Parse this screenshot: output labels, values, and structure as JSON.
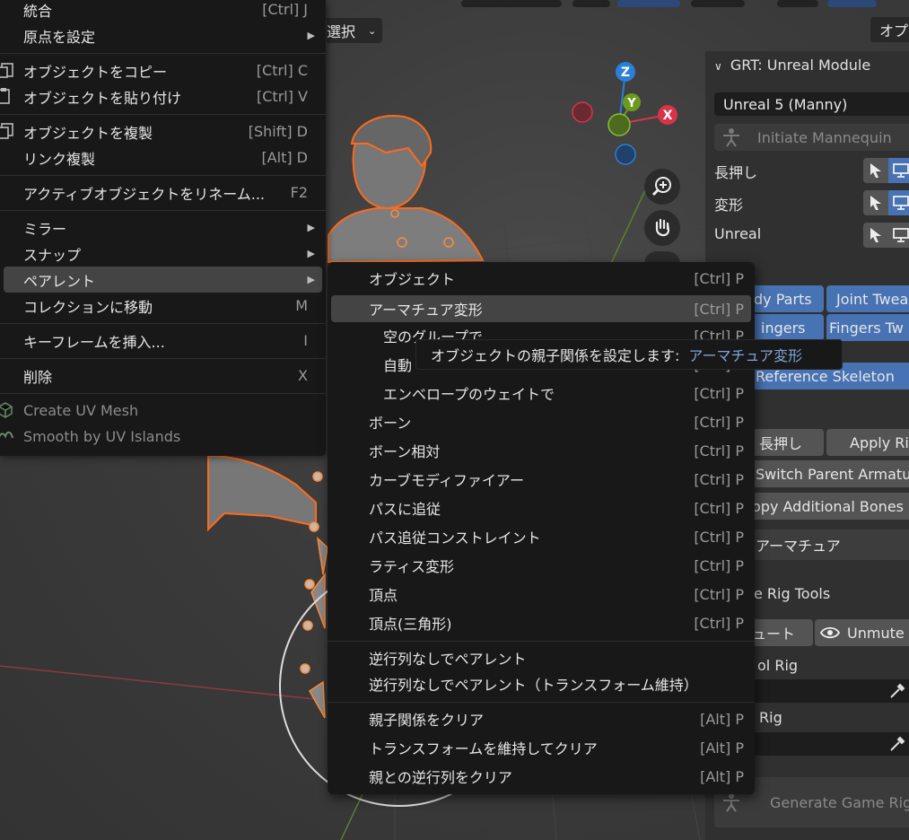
{
  "viewport": {
    "select_label": "選択",
    "top_right_label": "オプ",
    "gizmo": {
      "z": "Z",
      "y": "Y",
      "x": "X"
    }
  },
  "colors": {
    "menu_bg": "#181818",
    "highlight": "#444444",
    "accent_blue": "#4772b3",
    "axis_x": "#d9334a",
    "axis_y": "#6c9a21",
    "axis_z": "#2a7fd6",
    "selection_orange": "#ff6a1a"
  },
  "panel": {
    "header": "GRT: Unreal Module",
    "preset_value": "Unreal 5 (Manny)",
    "initiate_label": "Initiate Mannequin",
    "rows": [
      "長押し",
      "変形",
      "Unreal"
    ],
    "body_parts": "dy Parts",
    "joint_tweak": "Joint Twea",
    "fingers": "ingers",
    "fingers_tw": "Fingers Tw",
    "reference_skeleton": "Reference Skeleton",
    "hold_label": "長押し",
    "apply_rig": "Apply Ri",
    "switch_parent": "Switch Parent Armatu",
    "copy_bones": "opy Additional Bones",
    "armature": "アーマチュア",
    "game_rig_tools": "e Rig Tools",
    "mute": "ュート",
    "unmute": "Unmute",
    "control_rig": "ol Rig",
    "rig": "Rig",
    "generate": "Generate Game Rig"
  },
  "menu": {
    "items": [
      {
        "label": "統合",
        "shortcut": "[Ctrl] J"
      },
      {
        "label": "原点を設定",
        "shortcut": ""
      },
      {
        "label": "オブジェクトをコピー",
        "shortcut": "[Ctrl] C"
      },
      {
        "label": "オブジェクトを貼り付け",
        "shortcut": "[Ctrl] V"
      },
      {
        "label": "オブジェクトを複製",
        "shortcut": "[Shift] D"
      },
      {
        "label": "リンク複製",
        "shortcut": "[Alt] D"
      },
      {
        "label": "アクティブオブジェクトをリネーム...",
        "shortcut": "F2"
      },
      {
        "label": "ミラー",
        "shortcut": ""
      },
      {
        "label": "スナップ",
        "shortcut": ""
      },
      {
        "label": "ペアレント",
        "shortcut": ""
      },
      {
        "label": "コレクションに移動",
        "shortcut": "M"
      },
      {
        "label": "キーフレームを挿入...",
        "shortcut": "I"
      },
      {
        "label": "削除",
        "shortcut": "X"
      },
      {
        "label": "Create UV Mesh",
        "shortcut": ""
      },
      {
        "label": "Smooth by UV Islands",
        "shortcut": ""
      }
    ]
  },
  "submenu": {
    "items": [
      {
        "label": "オブジェクト",
        "shortcut": "[Ctrl] P"
      },
      {
        "label": "アーマチュア変形",
        "shortcut": "[Ctrl] P"
      },
      {
        "label": "空のグループで",
        "shortcut": "[Ctrl] P"
      },
      {
        "label": "自動",
        "shortcut": "[Ctrl] P"
      },
      {
        "label": "エンベロープのウェイトで",
        "shortcut": "[Ctrl] P"
      },
      {
        "label": "ボーン",
        "shortcut": "[Ctrl] P"
      },
      {
        "label": "ボーン相対",
        "shortcut": "[Ctrl] P"
      },
      {
        "label": "カーブモディファイアー",
        "shortcut": "[Ctrl] P"
      },
      {
        "label": "パスに追従",
        "shortcut": "[Ctrl] P"
      },
      {
        "label": "パス追従コンストレイント",
        "shortcut": "[Ctrl] P"
      },
      {
        "label": "ラティス変形",
        "shortcut": "[Ctrl] P"
      },
      {
        "label": "頂点",
        "shortcut": "[Ctrl] P"
      },
      {
        "label": "頂点(三角形)",
        "shortcut": "[Ctrl] P"
      },
      {
        "label": "逆行列なしでペアレント",
        "shortcut": ""
      },
      {
        "label": "逆行列なしでペアレント（トランスフォーム維持）",
        "shortcut": ""
      },
      {
        "label": "親子関係をクリア",
        "shortcut": "[Alt] P"
      },
      {
        "label": "トランスフォームを維持してクリア",
        "shortcut": "[Alt] P"
      },
      {
        "label": "親との逆行列をクリア",
        "shortcut": "[Alt] P"
      }
    ]
  },
  "tooltip": {
    "text": "オブジェクトの親子関係を設定します:",
    "value": "アーマチュア変形"
  }
}
